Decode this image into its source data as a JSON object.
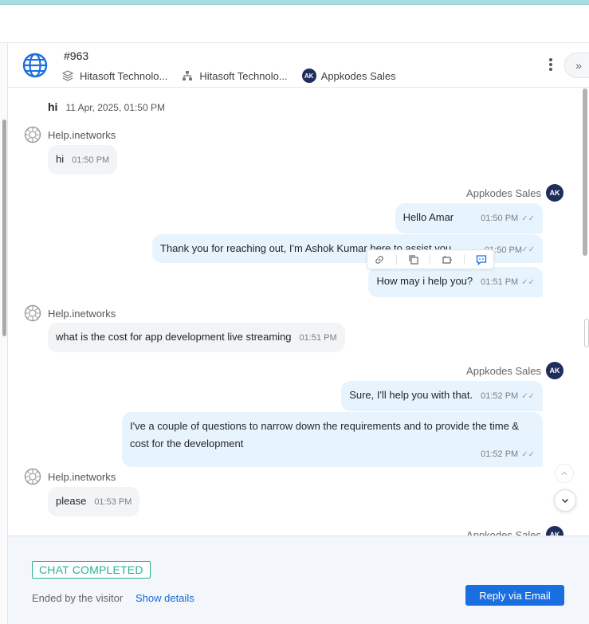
{
  "header": {
    "conversation_id": "#963",
    "company_one": "Hitasoft Technolo...",
    "company_two": "Hitasoft Technolo...",
    "agent_badge": "AK",
    "agent_name": "Appkodes Sales",
    "colors": {
      "globe": "#1a6fe0",
      "badge": "#1f2d5a"
    }
  },
  "chat": {
    "first_message": {
      "text": "hi",
      "timestamp": "11 Apr, 2025, 01:50 PM"
    },
    "visitor_name": "Help.inetworks",
    "agent_name": "Appkodes Sales",
    "messages": [
      {
        "text": "hi",
        "time": "01:50 PM"
      },
      {
        "text": "Hello Amar",
        "time": "01:50 PM"
      },
      {
        "text": "Thank you for reaching out, I'm Ashok Kumar here to assist you.",
        "time": "01:50 PM"
      },
      {
        "text": "How may i help you?",
        "time": "01:51 PM"
      },
      {
        "text": "what is the cost for app development live streaming",
        "time": "01:51 PM"
      },
      {
        "text": "Sure, I'll help you with that.",
        "time": "01:52 PM"
      },
      {
        "text": "I've a couple of questions to narrow down the requirements and to provide the time & cost for the development",
        "time": "01:52 PM"
      },
      {
        "text": "please",
        "time": "01:53 PM"
      }
    ],
    "read_tick": "✓✓",
    "toolbar_icons": [
      "link-icon",
      "copy-icon",
      "forward-icon",
      "translate-icon"
    ]
  },
  "footer": {
    "status": "CHAT COMPLETED",
    "ended_text": "Ended by the visitor",
    "details_link": "Show details",
    "reply_button": "Reply via Email",
    "colors": {
      "status": "#28b48c",
      "link": "#1769d8",
      "button": "#1a6fe0"
    }
  },
  "icons": {
    "expand": "»"
  }
}
